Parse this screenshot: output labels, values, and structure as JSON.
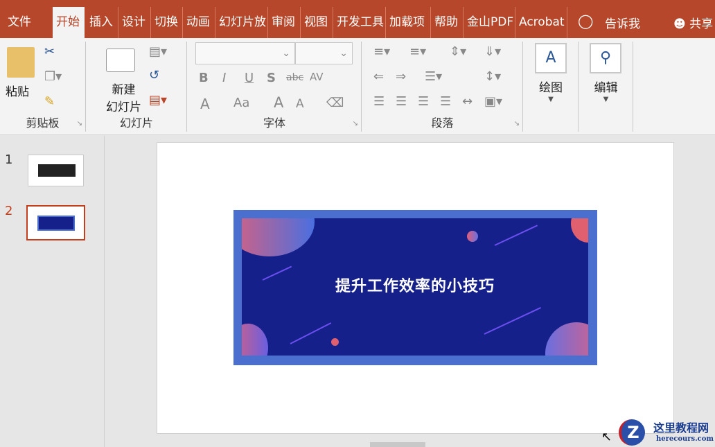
{
  "tabs": [
    "文件",
    "开始",
    "插入",
    "设计",
    "切换",
    "动画",
    "幻灯片放",
    "审阅",
    "视图",
    "开发工具",
    "加载项",
    "帮助",
    "金山PDF",
    "Acrobat"
  ],
  "tell_me": "告诉我",
  "share": "共享",
  "clipboard": {
    "paste": "粘贴",
    "label": "剪贴板"
  },
  "slides_group": {
    "new_slide_1": "新建",
    "new_slide_2": "幻灯片",
    "label": "幻灯片"
  },
  "font": {
    "label": "字体",
    "bold": "B",
    "italic": "I",
    "underline": "U",
    "shadow": "S",
    "strike": "abc",
    "spacing": "AV",
    "color": "A",
    "case": "Aa",
    "grow": "A",
    "shrink": "A"
  },
  "paragraph": {
    "label": "段落"
  },
  "drawing": {
    "label": "绘图"
  },
  "editing": {
    "label": "编辑"
  },
  "thumbnails": [
    {
      "number": "1"
    },
    {
      "number": "2"
    }
  ],
  "slide": {
    "title": "提升工作效率的小技巧"
  },
  "watermark": {
    "name": "这里教程网",
    "url": "herecours.com"
  },
  "colors": {
    "accent": "#b7472a",
    "slide_bg": "#16208a",
    "slide_border": "#4a6fcf"
  }
}
